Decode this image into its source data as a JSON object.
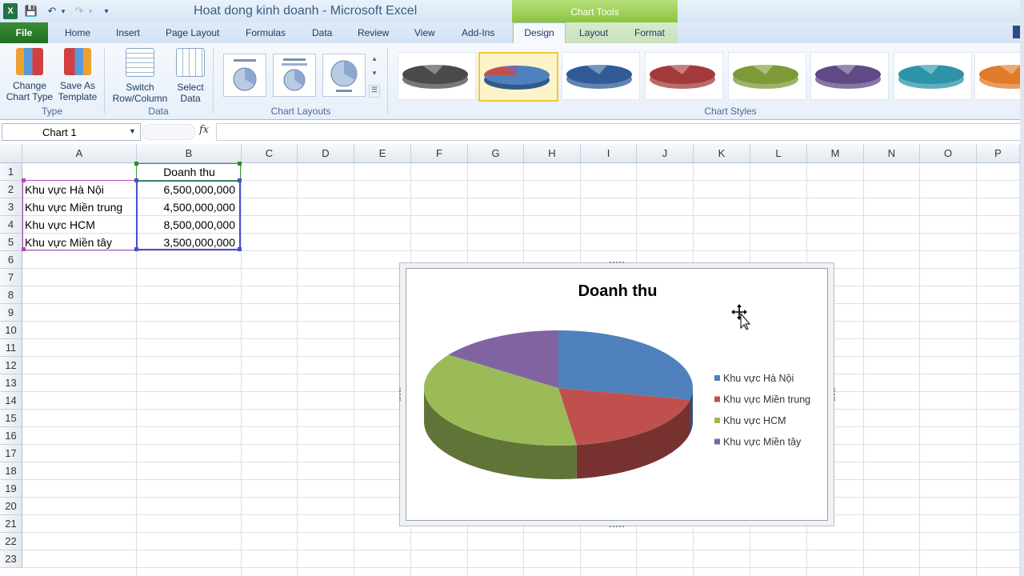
{
  "window": {
    "title": "Hoat dong kinh doanh -  Microsoft Excel",
    "context_tab_group": "Chart Tools"
  },
  "ribbon_tabs": [
    "Home",
    "Insert",
    "Page Layout",
    "Formulas",
    "Data",
    "Review",
    "View",
    "Add-Ins",
    "Design",
    "Layout",
    "Format"
  ],
  "file_tab": "File",
  "active_tab": "Design",
  "ribbon": {
    "type_group": {
      "label": "Type",
      "change_chart_type": "Change\nChart Type",
      "save_as_template": "Save As\nTemplate"
    },
    "data_group": {
      "label": "Data",
      "switch_row_column": "Switch\nRow/Column",
      "select_data": "Select\nData"
    },
    "chart_layouts_label": "Chart Layouts",
    "chart_styles_label": "Chart Styles",
    "style_colors": [
      "#4a4a4a",
      "#4f81bd",
      "#2f5b96",
      "#a33a3a",
      "#7d9a36",
      "#5f4a87",
      "#2c93a8",
      "#e07b2a"
    ],
    "selected_style_index": 1
  },
  "formula_bar": {
    "name_box": "Chart 1",
    "fx": "fx",
    "formula": ""
  },
  "columns": [
    "A",
    "B",
    "C",
    "D",
    "E",
    "F",
    "G",
    "H",
    "I",
    "J",
    "K",
    "L",
    "M",
    "N",
    "O",
    "P"
  ],
  "rows": [
    "1",
    "2",
    "3",
    "4",
    "5",
    "6",
    "7",
    "8",
    "9",
    "10",
    "11",
    "12",
    "13",
    "14",
    "15",
    "16",
    "17",
    "18",
    "19",
    "20",
    "21",
    "22",
    "23"
  ],
  "cells": {
    "B1": "Doanh thu",
    "A2": "Khu vực Hà Nội",
    "B2": "6,500,000,000",
    "A3": "Khu vực Miền trung",
    "B3": "4,500,000,000",
    "A4": "Khu vực HCM",
    "B4": "8,500,000,000",
    "A5": "Khu vực Miền tây",
    "B5": "3,500,000,000"
  },
  "chart_data": {
    "type": "pie",
    "title": "Doanh thu",
    "categories": [
      "Khu vực Hà Nội",
      "Khu vực Miền trung",
      "Khu vực HCM",
      "Khu vực Miền tây"
    ],
    "values": [
      6500000000,
      4500000000,
      8500000000,
      3500000000
    ],
    "colors": [
      "#4f81bd",
      "#c0504d",
      "#9bbb59",
      "#8064a2"
    ],
    "legend_position": "right",
    "style": "3d"
  }
}
